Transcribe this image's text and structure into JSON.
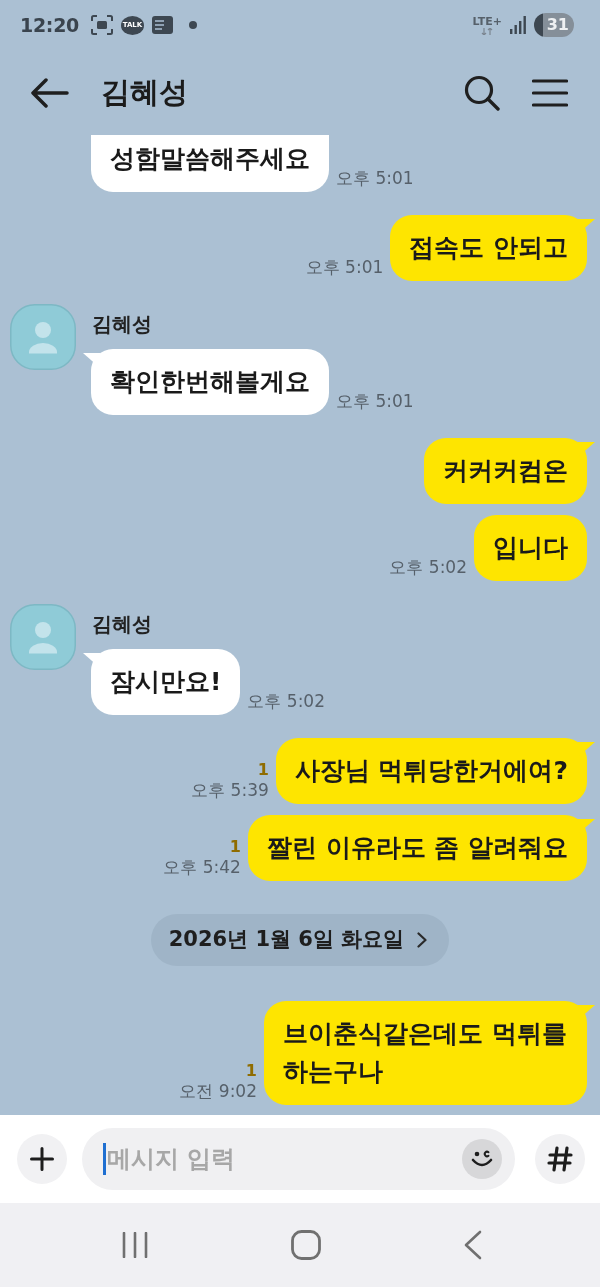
{
  "status_bar": {
    "time": "12:20",
    "notifications": [
      {
        "kind": "screenshot"
      },
      {
        "kind": "talk",
        "label": "TALK"
      },
      {
        "kind": "document"
      },
      {
        "kind": "dot"
      }
    ],
    "network": "LTE+",
    "battery": "31"
  },
  "header": {
    "title": "김혜성"
  },
  "chat": [
    {
      "kind": "incoming",
      "text": "성함말씀해주세요",
      "time": "오후 5:01",
      "tail": false
    },
    {
      "kind": "outgoing",
      "text": "접속도 안되고",
      "time": "오후 5:01",
      "tail": true
    },
    {
      "kind": "incoming",
      "sender": "김혜성",
      "text": "확인한번해볼게요",
      "time": "오후 5:01",
      "tail": true
    },
    {
      "kind": "outgoing",
      "text": "커커커컴온",
      "tail": true
    },
    {
      "kind": "outgoing",
      "text": "입니다",
      "time": "오후 5:02",
      "tail": false
    },
    {
      "kind": "incoming",
      "sender": "김혜성",
      "text": "잠시만요!",
      "time": "오후 5:02",
      "tail": true
    },
    {
      "kind": "outgoing",
      "text": "사장님 먹튀당한거에여?",
      "unread": "1",
      "time": "오후 5:39",
      "tail": true
    },
    {
      "kind": "outgoing",
      "text": "짤린 이유라도 좀 알려줘요",
      "unread": "1",
      "time": "오후 5:42",
      "tail": true
    },
    {
      "kind": "date",
      "text": "2026년 1월 6일 화요일"
    },
    {
      "kind": "outgoing",
      "text": "브이춘식같은데도 먹튀를 하는구나",
      "unread": "1",
      "time": "오전 9:02",
      "tail": true
    }
  ],
  "input": {
    "placeholder": "메시지 입력"
  }
}
